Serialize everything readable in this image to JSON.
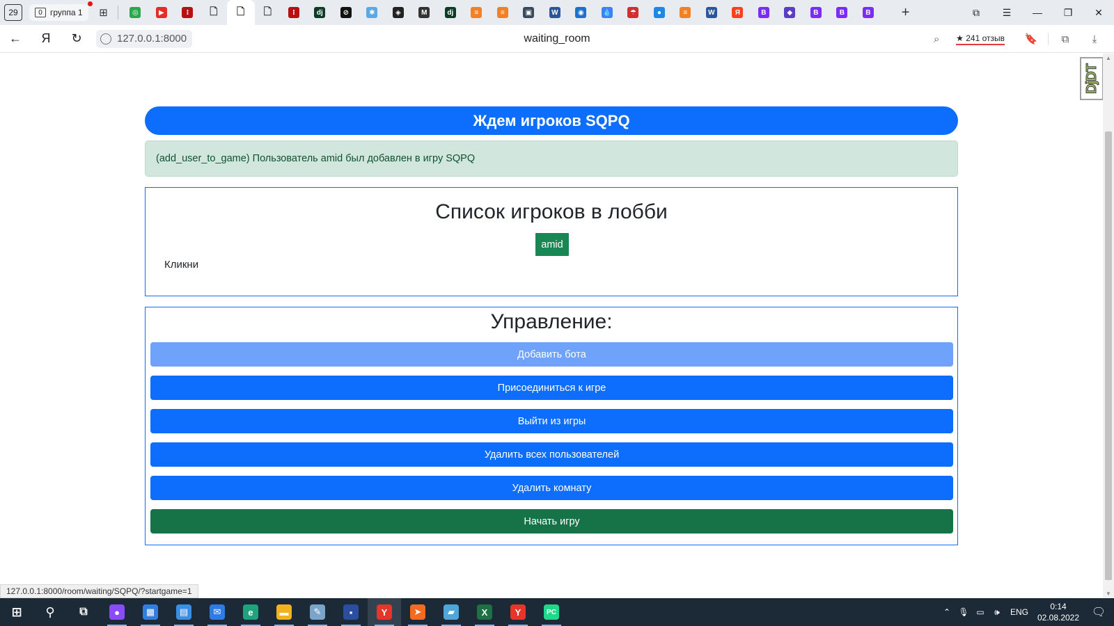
{
  "browser": {
    "tab_counter": "29",
    "group": {
      "count": "0",
      "label": "группа 1"
    },
    "url": "127.0.0.1:8000",
    "page_title": "waiting_room",
    "rating": "★ 241 отзыв",
    "tabs": [
      {
        "icon": "green-circle-icon",
        "color": "#2aa84a",
        "glyph": "◎"
      },
      {
        "icon": "youtube-icon",
        "color": "#e52d27",
        "glyph": "▶"
      },
      {
        "icon": "red-dots-icon",
        "color": "#b80f0f",
        "glyph": "⁝"
      },
      {
        "icon": "document-icon",
        "color": "#ffffff",
        "glyph": "🗋"
      },
      {
        "icon": "document-icon",
        "color": "#ffffff",
        "glyph": "🗋"
      },
      {
        "icon": "document-icon",
        "color": "#ffffff",
        "glyph": "🗋"
      },
      {
        "icon": "red-dots-icon",
        "color": "#b80f0f",
        "glyph": "⁝"
      },
      {
        "icon": "django-icon",
        "color": "#0c3c26",
        "glyph": "dj"
      },
      {
        "icon": "circle-slash-icon",
        "color": "#111111",
        "glyph": "⊘"
      },
      {
        "icon": "bluesquare-icon",
        "color": "#5aa9e6",
        "glyph": "✱"
      },
      {
        "icon": "codepen-icon",
        "color": "#222222",
        "glyph": "◈"
      },
      {
        "icon": "m-icon",
        "color": "#333333",
        "glyph": "M"
      },
      {
        "icon": "django-icon",
        "color": "#0c3c26",
        "glyph": "dj"
      },
      {
        "icon": "stackoverflow-icon",
        "color": "#f48024",
        "glyph": "≡"
      },
      {
        "icon": "stackoverflow-icon",
        "color": "#f48024",
        "glyph": "≡"
      },
      {
        "icon": "square-app-icon",
        "color": "#3a4a5a",
        "glyph": "▣"
      },
      {
        "icon": "word-icon",
        "color": "#2b579a",
        "glyph": "W"
      },
      {
        "icon": "outlook-icon",
        "color": "#1f6fd1",
        "glyph": "◉"
      },
      {
        "icon": "drop-icon",
        "color": "#3b82f6",
        "glyph": "💧"
      },
      {
        "icon": "mushroom-icon",
        "color": "#d32f2f",
        "glyph": "☂"
      },
      {
        "icon": "drop-dark-icon",
        "color": "#1e88e5",
        "glyph": "●"
      },
      {
        "icon": "stackoverflow-icon",
        "color": "#f48024",
        "glyph": "≡"
      },
      {
        "icon": "word-icon",
        "color": "#2b579a",
        "glyph": "W"
      },
      {
        "icon": "yandex-icon",
        "color": "#fc3f1d",
        "glyph": "Я"
      },
      {
        "icon": "bootstrap-icon",
        "color": "#7b2cf7",
        "glyph": "B"
      },
      {
        "icon": "layers-icon",
        "color": "#5b3cc4",
        "glyph": "◆"
      },
      {
        "icon": "bootstrap-icon",
        "color": "#7b2cf7",
        "glyph": "B"
      },
      {
        "icon": "bootstrap-icon",
        "color": "#7b2cf7",
        "glyph": "B"
      },
      {
        "icon": "bootstrap-icon",
        "color": "#7b2cf7",
        "glyph": "B"
      }
    ],
    "active_tab_index": 4
  },
  "page": {
    "djdt_label": "DjDT",
    "header": "Ждем игроков SQPQ",
    "alert": "(add_user_to_game) Пользователь amid был добавлен в игру SQPQ",
    "lobby": {
      "title": "Список игроков в лобби",
      "players": [
        "amid"
      ],
      "hint": "Кликни"
    },
    "controls": {
      "title": "Управление:",
      "buttons": [
        {
          "label": "Добавить бота",
          "style": "primary-hover"
        },
        {
          "label": "Присоединиться к игре",
          "style": "primary"
        },
        {
          "label": "Выйти из игры",
          "style": "primary"
        },
        {
          "label": "Удалить всех пользователей",
          "style": "primary"
        },
        {
          "label": "Удалить комнату",
          "style": "primary"
        },
        {
          "label": "Начать игру",
          "style": "success"
        }
      ]
    },
    "status_url": "127.0.0.1:8000/room/waiting/SQPQ/?startgame=1"
  },
  "taskbar": {
    "apps": [
      {
        "icon": "alice-icon",
        "color": "#8a4bff",
        "glyph": "●"
      },
      {
        "icon": "store-icon",
        "color": "#2f7fe0",
        "glyph": "▦"
      },
      {
        "icon": "control-panel-icon",
        "color": "#3a8ee6",
        "glyph": "▤"
      },
      {
        "icon": "mail-icon",
        "color": "#2d7be5",
        "glyph": "✉"
      },
      {
        "icon": "edge-icon",
        "color": "#1fa37c",
        "glyph": "e"
      },
      {
        "icon": "explorer-icon",
        "color": "#f2b21e",
        "glyph": "▬"
      },
      {
        "icon": "paint-icon",
        "color": "#7aa5c9",
        "glyph": "✎"
      },
      {
        "icon": "save-icon",
        "color": "#2b4ea0",
        "glyph": "▪"
      },
      {
        "icon": "yandex-browser-icon",
        "color": "#e8352a",
        "glyph": "Y"
      },
      {
        "icon": "compass-icon",
        "color": "#f26b21",
        "glyph": "➤"
      },
      {
        "icon": "notes-icon",
        "color": "#4ea6d9",
        "glyph": "▰"
      },
      {
        "icon": "excel-icon",
        "color": "#1e7145",
        "glyph": "X"
      },
      {
        "icon": "yandex-browser-icon",
        "color": "#e8352a",
        "glyph": "Y"
      },
      {
        "icon": "pycharm-icon",
        "color": "#21d789",
        "glyph": "PC"
      }
    ],
    "active_app_index": 8,
    "lang": "ENG",
    "time": "0:14",
    "date": "02.08.2022"
  }
}
